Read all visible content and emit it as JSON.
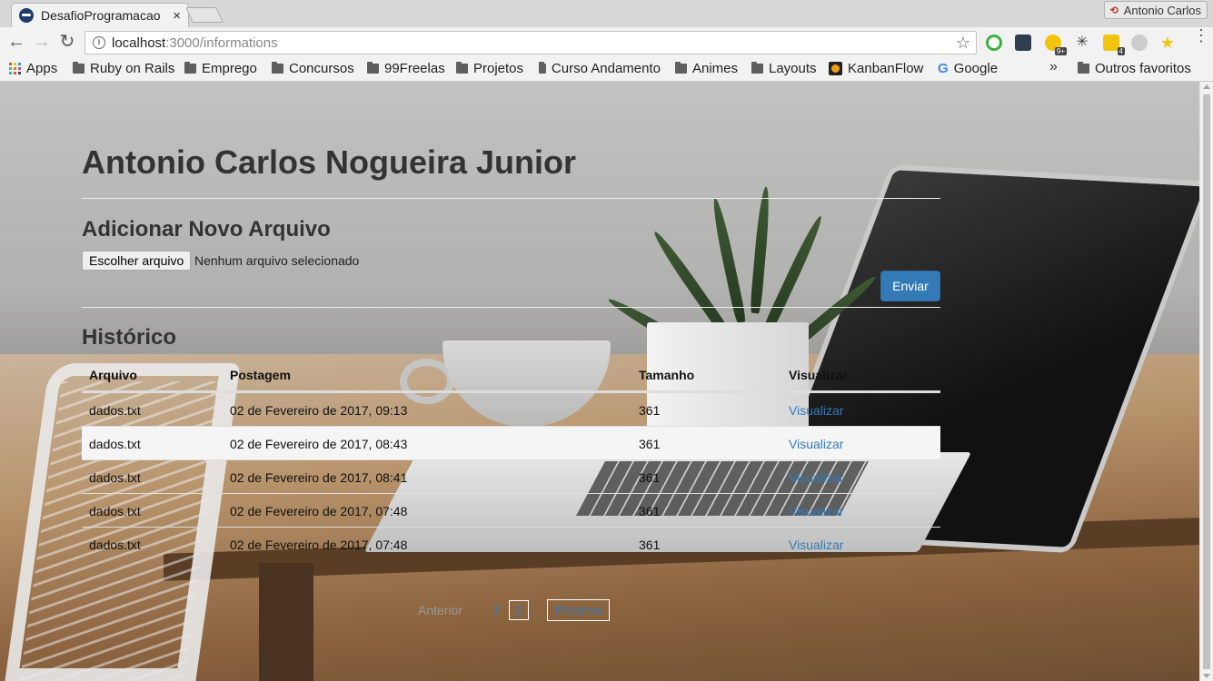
{
  "browser": {
    "tab": {
      "title": "DesafioProgramacao",
      "close_glyph": "×"
    },
    "profile": {
      "name": "Antonio Carlos"
    },
    "url": {
      "host": "localhost",
      "path": ":3000/informations"
    },
    "bookmarks": [
      {
        "label": "Apps",
        "icon": "apps-icon"
      },
      {
        "label": "Ruby on Rails",
        "icon": "folder-icon"
      },
      {
        "label": "Emprego",
        "icon": "folder-icon"
      },
      {
        "label": "Concursos",
        "icon": "folder-icon"
      },
      {
        "label": "99Freelas",
        "icon": "folder-icon"
      },
      {
        "label": "Projetos",
        "icon": "folder-icon"
      },
      {
        "label": "Curso Andamento",
        "icon": "folder-icon"
      },
      {
        "label": "Animes",
        "icon": "folder-icon"
      },
      {
        "label": "Layouts",
        "icon": "folder-icon"
      },
      {
        "label": "KanbanFlow",
        "icon": "kanbanflow-icon"
      },
      {
        "label": "Google",
        "icon": "google-icon"
      }
    ],
    "bookmarks_more": "»",
    "other_bookmarks": "Outros favoritos",
    "extension_badges": {
      "ext4": "9+",
      "ext6": "4"
    }
  },
  "page": {
    "title": "Antonio Carlos Nogueira Junior",
    "upload": {
      "heading": "Adicionar Novo Arquivo",
      "choose_label": "Escolher arquivo",
      "status": "Nenhum arquivo selecionado",
      "submit_label": "Enviar"
    },
    "history": {
      "heading": "Histórico",
      "columns": [
        "Arquivo",
        "Postagem",
        "Tamanho",
        "Visualizar"
      ],
      "rows": [
        {
          "file": "dados.txt",
          "posted": "02 de Fevereiro de 2017, 09:13",
          "size": "361",
          "action": "Visualizar"
        },
        {
          "file": "dados.txt",
          "posted": "02 de Fevereiro de 2017, 08:43",
          "size": "361",
          "action": "Visualizar"
        },
        {
          "file": "dados.txt",
          "posted": "02 de Fevereiro de 2017, 08:41",
          "size": "361",
          "action": "Visualizar"
        },
        {
          "file": "dados.txt",
          "posted": "02 de Fevereiro de 2017, 07:48",
          "size": "361",
          "action": "Visualizar"
        },
        {
          "file": "dados.txt",
          "posted": "02 de Fevereiro de 2017, 07:48",
          "size": "361",
          "action": "Visualizar"
        }
      ]
    },
    "pagination": {
      "prev": "Anterior",
      "pages": [
        "1",
        "2"
      ],
      "current": "2",
      "next": "Próximo"
    }
  },
  "colors": {
    "link": "#337ab7",
    "button_primary": "#337ab7",
    "text": "#333333"
  }
}
